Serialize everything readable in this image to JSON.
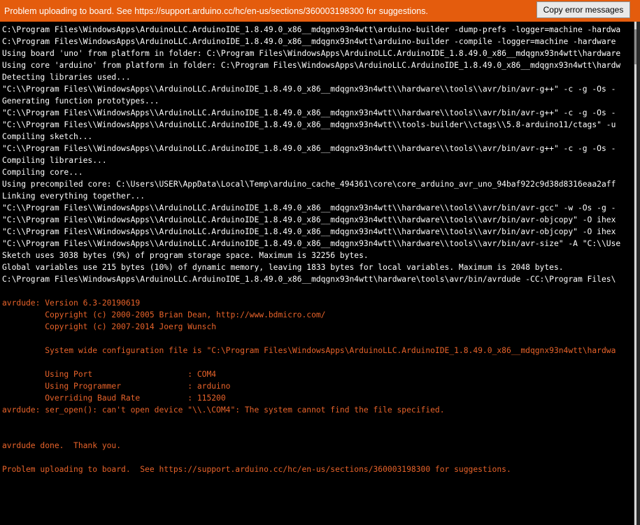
{
  "error_bar": {
    "message": "Problem uploading to board.  See https://support.arduino.cc/hc/en-us/sections/360003198300 for suggestions.",
    "copy_button_label": "Copy error messages"
  },
  "console": {
    "lines": [
      {
        "text": "C:\\Program Files\\WindowsApps\\ArduinoLLC.ArduinoIDE_1.8.49.0_x86__mdqgnx93n4wtt\\arduino-builder -dump-prefs -logger=machine -hardwa",
        "color": "white"
      },
      {
        "text": "C:\\Program Files\\WindowsApps\\ArduinoLLC.ArduinoIDE_1.8.49.0_x86__mdqgnx93n4wtt\\arduino-builder -compile -logger=machine -hardware",
        "color": "white"
      },
      {
        "text": "Using board 'uno' from platform in folder: C:\\Program Files\\WindowsApps\\ArduinoLLC.ArduinoIDE_1.8.49.0_x86__mdqgnx93n4wtt\\hardware",
        "color": "white"
      },
      {
        "text": "Using core 'arduino' from platform in folder: C:\\Program Files\\WindowsApps\\ArduinoLLC.ArduinoIDE_1.8.49.0_x86__mdqgnx93n4wtt\\hardw",
        "color": "white"
      },
      {
        "text": "Detecting libraries used...",
        "color": "white"
      },
      {
        "text": "\"C:\\\\Program Files\\\\WindowsApps\\\\ArduinoLLC.ArduinoIDE_1.8.49.0_x86__mdqgnx93n4wtt\\\\hardware\\\\tools\\\\avr/bin/avr-g++\" -c -g -Os -",
        "color": "white"
      },
      {
        "text": "Generating function prototypes...",
        "color": "white"
      },
      {
        "text": "\"C:\\\\Program Files\\\\WindowsApps\\\\ArduinoLLC.ArduinoIDE_1.8.49.0_x86__mdqgnx93n4wtt\\\\hardware\\\\tools\\\\avr/bin/avr-g++\" -c -g -Os -",
        "color": "white"
      },
      {
        "text": "\"C:\\\\Program Files\\\\WindowsApps\\\\ArduinoLLC.ArduinoIDE_1.8.49.0_x86__mdqgnx93n4wtt\\\\tools-builder\\\\ctags\\\\5.8-arduino11/ctags\" -u",
        "color": "white"
      },
      {
        "text": "Compiling sketch...",
        "color": "white"
      },
      {
        "text": "\"C:\\\\Program Files\\\\WindowsApps\\\\ArduinoLLC.ArduinoIDE_1.8.49.0_x86__mdqgnx93n4wtt\\\\hardware\\\\tools\\\\avr/bin/avr-g++\" -c -g -Os -",
        "color": "white"
      },
      {
        "text": "Compiling libraries...",
        "color": "white"
      },
      {
        "text": "Compiling core...",
        "color": "white"
      },
      {
        "text": "Using precompiled core: C:\\Users\\USER\\AppData\\Local\\Temp\\arduino_cache_494361\\core\\core_arduino_avr_uno_94baf922c9d38d8316eaa2aff",
        "color": "white"
      },
      {
        "text": "Linking everything together...",
        "color": "white"
      },
      {
        "text": "\"C:\\\\Program Files\\\\WindowsApps\\\\ArduinoLLC.ArduinoIDE_1.8.49.0_x86__mdqgnx93n4wtt\\\\hardware\\\\tools\\\\avr/bin/avr-gcc\" -w -Os -g -",
        "color": "white"
      },
      {
        "text": "\"C:\\\\Program Files\\\\WindowsApps\\\\ArduinoLLC.ArduinoIDE_1.8.49.0_x86__mdqgnx93n4wtt\\\\hardware\\\\tools\\\\avr/bin/avr-objcopy\" -O ihex",
        "color": "white"
      },
      {
        "text": "\"C:\\\\Program Files\\\\WindowsApps\\\\ArduinoLLC.ArduinoIDE_1.8.49.0_x86__mdqgnx93n4wtt\\\\hardware\\\\tools\\\\avr/bin/avr-objcopy\" -O ihex",
        "color": "white"
      },
      {
        "text": "\"C:\\\\Program Files\\\\WindowsApps\\\\ArduinoLLC.ArduinoIDE_1.8.49.0_x86__mdqgnx93n4wtt\\\\hardware\\\\tools\\\\avr/bin/avr-size\" -A \"C:\\\\Use",
        "color": "white"
      },
      {
        "text": "Sketch uses 3038 bytes (9%) of program storage space. Maximum is 32256 bytes.",
        "color": "white"
      },
      {
        "text": "Global variables use 215 bytes (10%) of dynamic memory, leaving 1833 bytes for local variables. Maximum is 2048 bytes.",
        "color": "white"
      },
      {
        "text": "C:\\Program Files\\WindowsApps\\ArduinoLLC.ArduinoIDE_1.8.49.0_x86__mdqgnx93n4wtt\\hardware\\tools\\avr/bin/avrdude -CC:\\Program Files\\",
        "color": "white"
      },
      {
        "text": "",
        "color": "white"
      },
      {
        "text": "avrdude: Version 6.3-20190619",
        "color": "orange"
      },
      {
        "text": "         Copyright (c) 2000-2005 Brian Dean, http://www.bdmicro.com/",
        "color": "orange"
      },
      {
        "text": "         Copyright (c) 2007-2014 Joerg Wunsch",
        "color": "orange"
      },
      {
        "text": "",
        "color": "orange"
      },
      {
        "text": "         System wide configuration file is \"C:\\Program Files\\WindowsApps\\ArduinoLLC.ArduinoIDE_1.8.49.0_x86__mdqgnx93n4wtt\\hardwa",
        "color": "orange"
      },
      {
        "text": "",
        "color": "orange"
      },
      {
        "text": "         Using Port                    : COM4",
        "color": "orange"
      },
      {
        "text": "         Using Programmer              : arduino",
        "color": "orange"
      },
      {
        "text": "         Overriding Baud Rate          : 115200",
        "color": "orange"
      },
      {
        "text": "avrdude: ser_open(): can't open device \"\\\\.\\COM4\": The system cannot find the file specified.",
        "color": "orange"
      },
      {
        "text": "",
        "color": "orange"
      },
      {
        "text": "",
        "color": "orange"
      },
      {
        "text": "avrdude done.  Thank you.",
        "color": "orange"
      },
      {
        "text": "",
        "color": "orange"
      },
      {
        "text": "Problem uploading to board.  See https://support.arduino.cc/hc/en-us/sections/360003198300 for suggestions.",
        "color": "orange"
      }
    ]
  },
  "colors": {
    "error_bar_bg": "#e45c0d",
    "console_bg": "#000000",
    "console_text": "#ffffff",
    "console_error_text": "#e8632a"
  }
}
